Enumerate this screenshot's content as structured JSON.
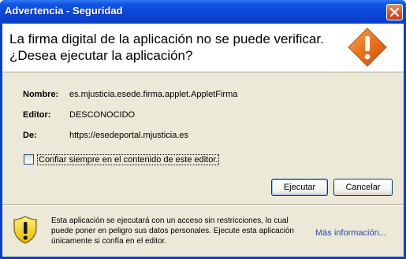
{
  "window": {
    "title": "Advertencia - Seguridad"
  },
  "header": {
    "message_line1": "La firma digital de la aplicación no se puede verificar.",
    "message_line2": "¿Desea ejecutar la aplicación?"
  },
  "details": [
    {
      "label": "Nombre:",
      "value": "es.mjusticia.esede.firma.applet.AppletFirma"
    },
    {
      "label": "Editor:",
      "value": "DESCONOCIDO"
    },
    {
      "label": "De:",
      "value": "https://esedeportal.mjusticia.es"
    }
  ],
  "trust_checkbox": {
    "label": "Confiar siempre en el contenido de este editor.",
    "checked": false
  },
  "buttons": {
    "run_label": "Ejecutar",
    "cancel_label": "Cancelar"
  },
  "footer": {
    "warning_text": "Esta aplicación se ejecutará con un acceso sin restricciones, lo cual puede poner en peligro sus datos personales. Ejecute esta aplicación únicamente si confía en el editor.",
    "more_info_label": "Más información..."
  },
  "colors": {
    "titlebar": "#0a46d6",
    "dialog_bg": "#ece9d8",
    "warning_orange": "#e8731a",
    "link": "#2a48a8"
  },
  "icons": {
    "header": "warning-diamond-icon",
    "footer": "warning-shield-icon",
    "close": "close-icon"
  }
}
